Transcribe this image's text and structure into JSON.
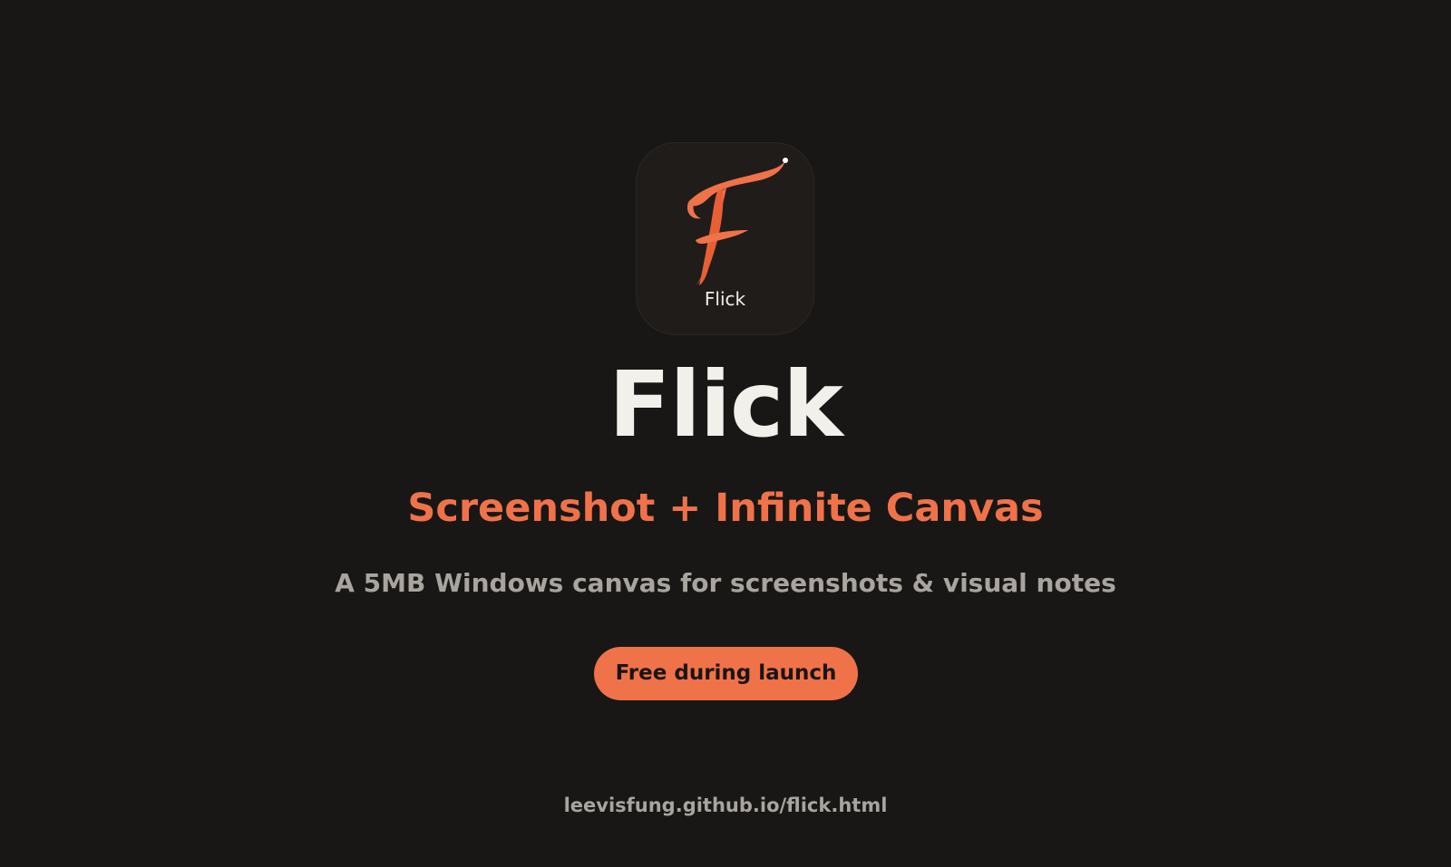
{
  "app_icon": {
    "label": "Flick",
    "icon_name": "flick-brush-f-logo",
    "accent_color": "#f07249",
    "tile_color": "#201c1a"
  },
  "hero": {
    "title": "Flick",
    "tagline": "Screenshot + Infinite Canvas",
    "subtitle": "A 5MB Windows canvas for screenshots & visual notes"
  },
  "cta": {
    "label": "Free during launch",
    "color": "#f07249"
  },
  "footer": {
    "link_text": "leevisfung.github.io/flick.html"
  },
  "colors": {
    "background": "#181716",
    "title": "#f2f0ea",
    "muted": "#a8a49e"
  }
}
